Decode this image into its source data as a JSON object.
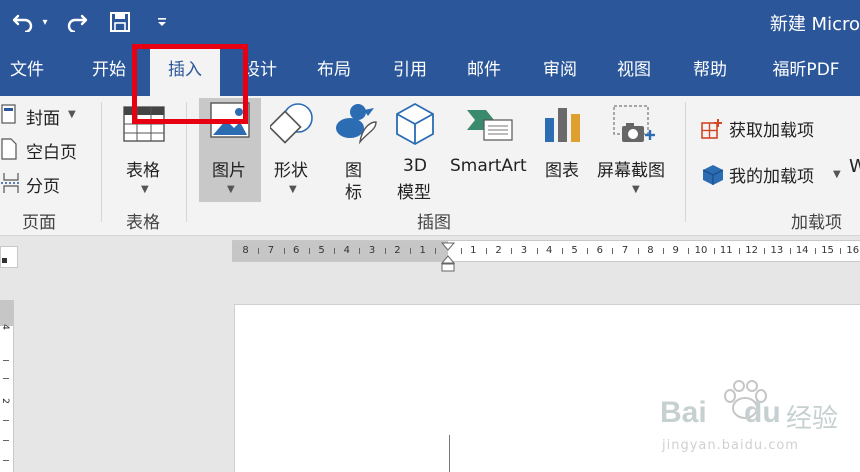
{
  "titlebar": {
    "title": "新建 Micro",
    "undo_icon": "undo-icon",
    "redo_icon": "redo-icon",
    "save_icon": "save-icon",
    "customize_icon": "customize-qat-icon"
  },
  "tabs": [
    {
      "label": "文件"
    },
    {
      "label": "开始"
    },
    {
      "label": "插入",
      "active": true
    },
    {
      "label": "设计"
    },
    {
      "label": "布局"
    },
    {
      "label": "引用"
    },
    {
      "label": "邮件"
    },
    {
      "label": "审阅"
    },
    {
      "label": "视图"
    },
    {
      "label": "帮助"
    },
    {
      "label": "福昕PDF"
    }
  ],
  "ribbon": {
    "pages_group": {
      "label": "页面",
      "cover": "封面",
      "blank": "空白页",
      "break": "分页"
    },
    "table_group": {
      "label": "表格",
      "table": "表格"
    },
    "illustrations_group": {
      "label": "插图",
      "picture": "图片",
      "shapes": "形状",
      "icons_1": "图",
      "icons_2": "标",
      "model_1": "3D",
      "model_2": "模型",
      "smartart": "SmartArt",
      "chart": "图表",
      "screenshot": "屏幕截图"
    },
    "addins_group": {
      "label": "加载项",
      "get_addins": "获取加载项",
      "my_addins": "我的加载项",
      "wiki_partial": "W"
    }
  },
  "ruler": {
    "left_ticks": [
      "8",
      "7",
      "6",
      "5",
      "4",
      "3",
      "2",
      "1"
    ],
    "right_ticks": [
      "1",
      "2",
      "3",
      "4",
      "5",
      "6",
      "7",
      "8",
      "9",
      "10",
      "11",
      "12",
      "13",
      "14",
      "15",
      "16"
    ]
  },
  "watermark": {
    "brand": "Bai",
    "brand2": "du",
    "cn": "经验",
    "url": "jingyan.baidu.com"
  },
  "colors": {
    "brand_blue": "#2b579a",
    "ribbon_bg": "#f3f3f3",
    "highlight_red": "#e60012"
  }
}
